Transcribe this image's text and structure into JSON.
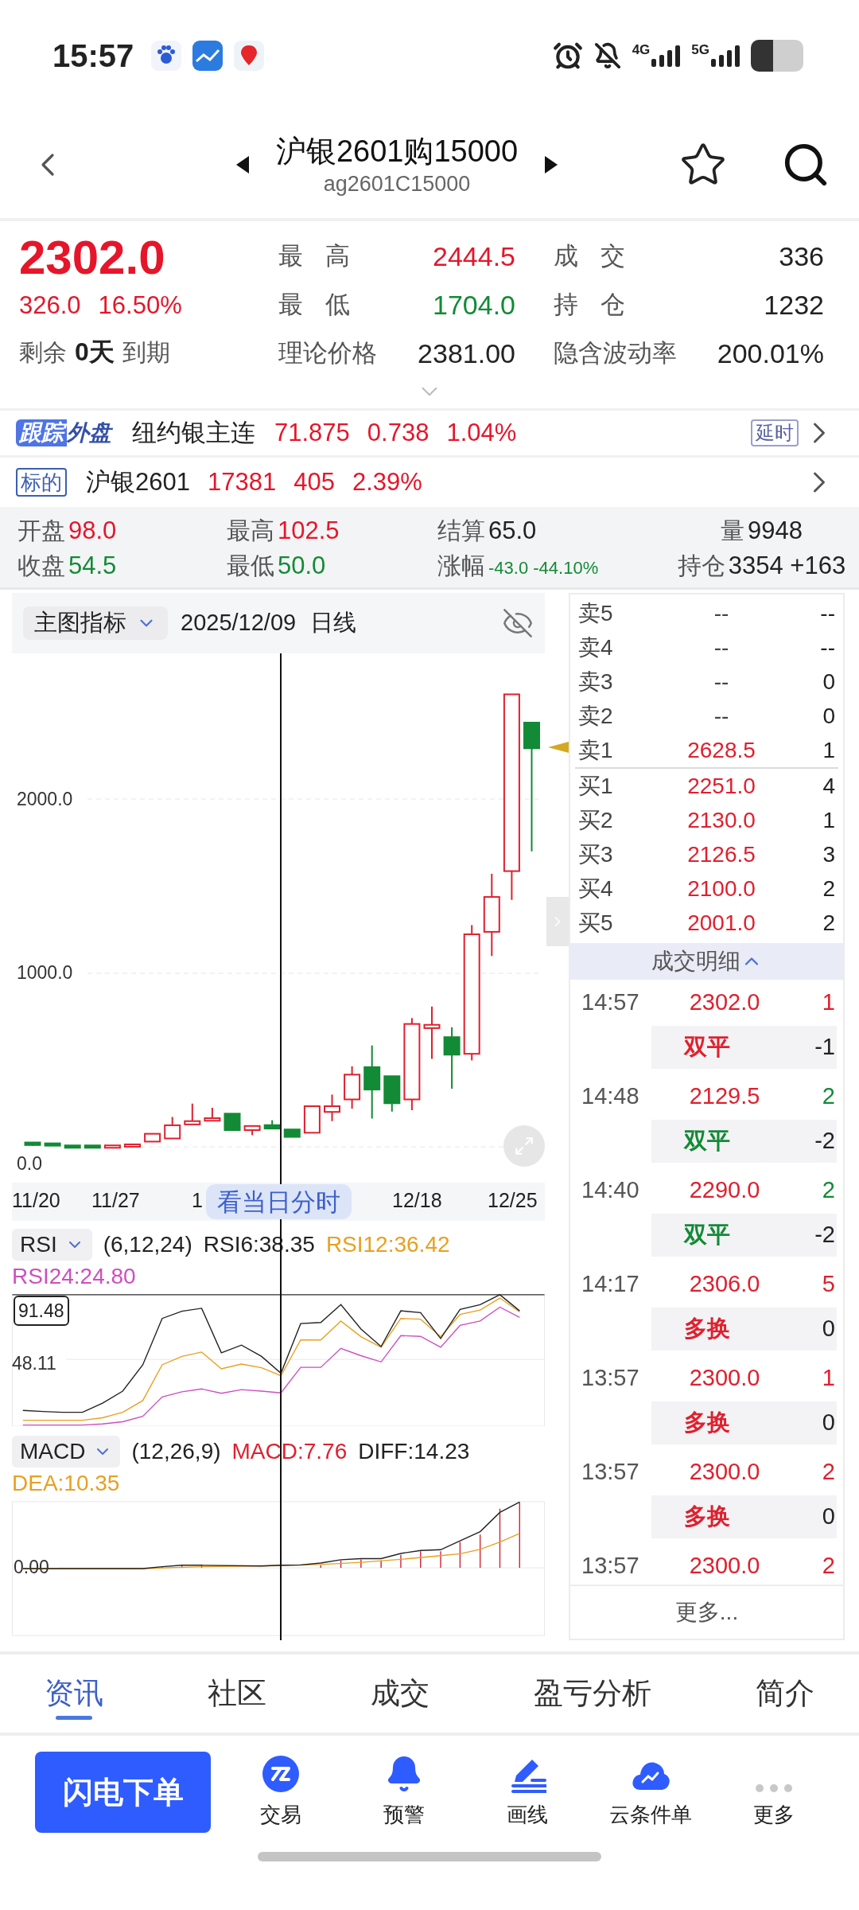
{
  "status_bar": {
    "time": "15:57",
    "network_1": "4G",
    "network_2": "5G"
  },
  "header": {
    "title": "沪银2601购15000",
    "code": "ag2601C15000"
  },
  "quote": {
    "price": "2302.0",
    "change": "326.0",
    "change_pct": "16.50%",
    "remaining_label": "剩余",
    "remaining_days": "0天",
    "remaining_suffix": "到期",
    "stats": [
      {
        "label": "最高",
        "value": "2444.5",
        "color": "#e5162a",
        "spaced": true
      },
      {
        "label": "成交",
        "value": "336",
        "color": "#222222",
        "spaced": true
      },
      {
        "label": "最低",
        "value": "1704.0",
        "color": "#138a36",
        "spaced": true
      },
      {
        "label": "持仓",
        "value": "1232",
        "color": "#222222",
        "spaced": true
      },
      {
        "label": "理论价格",
        "value": "2381.00",
        "color": "#222222",
        "spaced": false
      },
      {
        "label": "隐含波动率",
        "value": "200.01%",
        "color": "#222222",
        "spaced": false
      }
    ]
  },
  "tracking": {
    "badge_1": "跟踪",
    "badge_2": "外盘",
    "name": "纽约银主连",
    "price": "71.875",
    "change": "0.738",
    "change_pct": "1.04%",
    "tag": "延时"
  },
  "underlying": {
    "badge": "标的",
    "name": "沪银2601",
    "price": "17381",
    "change": "405",
    "change_pct": "2.39%"
  },
  "daily_stats": [
    {
      "label": "开盘",
      "value": "98.0",
      "color": "#e5162a",
      "kind": "normal"
    },
    {
      "label": "最高",
      "value": "102.5",
      "color": "#e5162a",
      "kind": "normal"
    },
    {
      "label": "结算",
      "value": "65.0",
      "color": "#222222",
      "kind": "normal"
    },
    {
      "label": "量",
      "value": "9948",
      "color": "#222222",
      "kind": "normal"
    },
    {
      "label": "收盘",
      "value": "54.5",
      "color": "#138a36",
      "kind": "normal"
    },
    {
      "label": "最低",
      "value": "50.0",
      "color": "#138a36",
      "kind": "normal"
    },
    {
      "label": "涨幅",
      "value": "-43.0  -44.10%",
      "color": "#138a36",
      "kind": "small"
    },
    {
      "label": "持仓",
      "value": "3354 +163",
      "color": "#222222",
      "kind": "normal"
    }
  ],
  "chart": {
    "indicator_menu": "主图指标",
    "date": "2025/12/09",
    "period": "日线",
    "y_labels": [
      "2000.0",
      "1000.0",
      "0.0"
    ],
    "x_labels": [
      "11/20",
      "11/27",
      "1",
      "12/18",
      "12/25"
    ],
    "intraday_button": "看当日分时"
  },
  "rsi": {
    "menu": "RSI",
    "params": "(6,12,24)",
    "values": [
      {
        "text": "RSI6:38.35",
        "color": "#222222"
      },
      {
        "text": "RSI12:36.42",
        "color": "#e8a020"
      },
      {
        "text": "RSI24:24.80",
        "color": "#cc4fc0"
      }
    ],
    "max_label": "91.48",
    "mid_label": "48.11"
  },
  "macd": {
    "menu": "MACD",
    "params": "(12,26,9)",
    "values": [
      {
        "text": "MACD:7.76",
        "color": "#e0202e"
      },
      {
        "text": "DIFF:14.23",
        "color": "#222222"
      },
      {
        "text": "DEA:10.35",
        "color": "#e8a020"
      }
    ],
    "zero_label": "0.00"
  },
  "order_book": {
    "asks": [
      {
        "label": "卖5",
        "price": "--",
        "volume": "--",
        "color": "#444444"
      },
      {
        "label": "卖4",
        "price": "--",
        "volume": "--",
        "color": "#444444"
      },
      {
        "label": "卖3",
        "price": "--",
        "volume": "0",
        "color": "#444444"
      },
      {
        "label": "卖2",
        "price": "--",
        "volume": "0",
        "color": "#444444"
      },
      {
        "label": "卖1",
        "price": "2628.5",
        "volume": "1",
        "color": "#e0202e"
      }
    ],
    "bids": [
      {
        "label": "买1",
        "price": "2251.0",
        "volume": "4",
        "color": "#e0202e"
      },
      {
        "label": "买2",
        "price": "2130.0",
        "volume": "1",
        "color": "#e0202e"
      },
      {
        "label": "买3",
        "price": "2126.5",
        "volume": "3",
        "color": "#e0202e"
      },
      {
        "label": "买4",
        "price": "2100.0",
        "volume": "2",
        "color": "#e0202e"
      },
      {
        "label": "买5",
        "price": "2001.0",
        "volume": "2",
        "color": "#e0202e"
      }
    ]
  },
  "trades": {
    "title": "成交明细",
    "expanded": true,
    "more": "更多...",
    "items": [
      {
        "time": "14:57",
        "price": "2302.0",
        "volume": "1",
        "color": "#e0202e",
        "type": "双平",
        "change": "-1"
      },
      {
        "time": "14:48",
        "price": "2129.5",
        "volume": "2",
        "color": "#138a36",
        "type": "双平",
        "change": "-2"
      },
      {
        "time": "14:40",
        "price": "2290.0",
        "volume": "2",
        "color": "#138a36",
        "type": "双平",
        "change": "-2"
      },
      {
        "time": "14:17",
        "price": "2306.0",
        "volume": "5",
        "color": "#e0202e",
        "type": "多换",
        "change": "0"
      },
      {
        "time": "13:57",
        "price": "2300.0",
        "volume": "1",
        "color": "#e0202e",
        "type": "多换",
        "change": "0"
      },
      {
        "time": "13:57",
        "price": "2300.0",
        "volume": "2",
        "color": "#e0202e",
        "type": "多换",
        "change": "0"
      },
      {
        "time": "13:57",
        "price": "2300.0",
        "volume": "2",
        "color": "#e0202e"
      }
    ]
  },
  "tabs": [
    {
      "label": "资讯",
      "selected": true
    },
    {
      "label": "社区",
      "selected": false
    },
    {
      "label": "成交",
      "selected": false
    },
    {
      "label": "盈亏分析",
      "selected": false
    },
    {
      "label": "简介",
      "selected": false
    }
  ],
  "action_bar": {
    "primary": "闪电下单",
    "items": [
      {
        "label": "交易",
        "kind": "trade"
      },
      {
        "label": "预警",
        "kind": "alert"
      },
      {
        "label": "画线",
        "kind": "draw"
      },
      {
        "label": "云条件单",
        "kind": "cloud"
      },
      {
        "label": "更多",
        "kind": "more"
      }
    ]
  }
}
